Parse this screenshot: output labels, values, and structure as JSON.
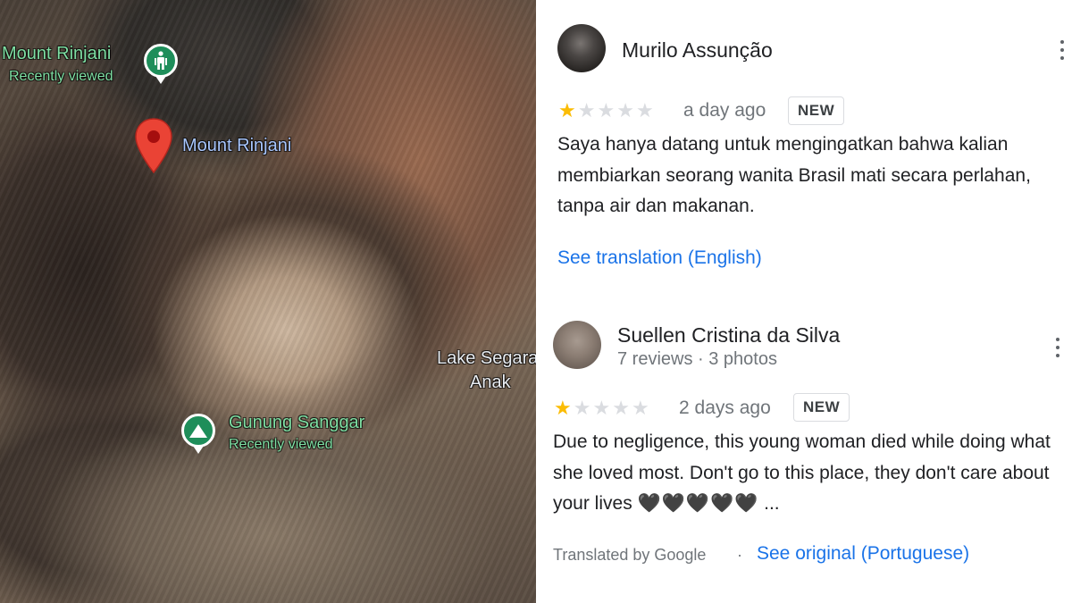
{
  "map": {
    "labels": {
      "mount_rinjani_top": "Mount Rinjani",
      "recently_viewed_1": "Recently viewed",
      "mount_rinjani_pin": "Mount Rinjani",
      "lake_line1": "Lake Segara",
      "lake_line2": "Anak",
      "gunung_sanggar": "Gunung Sanggar",
      "recently_viewed_2": "Recently viewed"
    },
    "icons": {
      "poi_hiking": "hiking-icon",
      "poi_mountain": "mountain-icon",
      "pin": "map-pin-icon"
    },
    "colors": {
      "poi_green": "#1e8e5a",
      "pin_red": "#ea4335"
    }
  },
  "reviews": [
    {
      "author": "Murilo Assunção",
      "meta": "",
      "rating": 1,
      "max_rating": 5,
      "date": "a day ago",
      "badge": "NEW",
      "text": "Saya hanya datang untuk mengingatkan bahwa kalian membiarkan seorang wanita Brasil mati secara perlahan, tanpa air dan makanan.",
      "link": "See translation (English)"
    },
    {
      "author": "Suellen Cristina da Silva",
      "meta": "7 reviews · 3 photos",
      "rating": 1,
      "max_rating": 5,
      "date": "2 days ago",
      "badge": "NEW",
      "text": "Due to negligence, this young woman died while doing what she loved most. Don't go to this place, they don't care about your lives",
      "hearts": "🖤🖤🖤🖤🖤",
      "ellipsis": "...",
      "translated_by": "Translated by Google",
      "separator": "·",
      "link": "See original (Portuguese)"
    }
  ],
  "colors": {
    "star_on": "#fbbc04",
    "star_off": "#dadce0",
    "link": "#1a73e8"
  }
}
